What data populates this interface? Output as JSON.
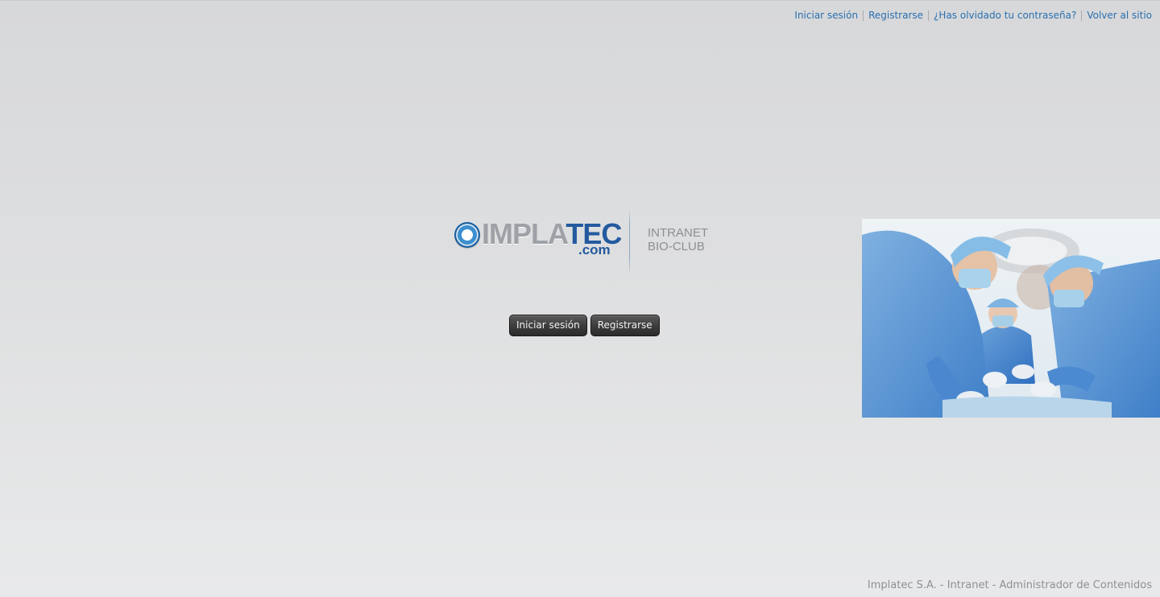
{
  "top_nav": {
    "links": [
      {
        "label": "Iniciar sesión"
      },
      {
        "label": "Registrarse"
      },
      {
        "label": "¿Has olvidado tu contraseña?"
      },
      {
        "label": "Volver al sitio"
      }
    ],
    "link_color": "#2a6fae"
  },
  "logo": {
    "word_part1": "IMPLA",
    "word_part2": "TEC",
    "domain": ".com",
    "sub_line1": "INTRANET",
    "sub_line2": "BIO-CLUB",
    "brand_blue": "#245a9e",
    "brand_gray": "#9ea1a6"
  },
  "actions": {
    "login_label": "Iniciar sesión",
    "register_label": "Registrarse"
  },
  "photo": {
    "subject": "surgeons-operating-photo"
  },
  "footer": {
    "text": "Implatec S.A. - Intranet - Administrador de Contenidos"
  }
}
